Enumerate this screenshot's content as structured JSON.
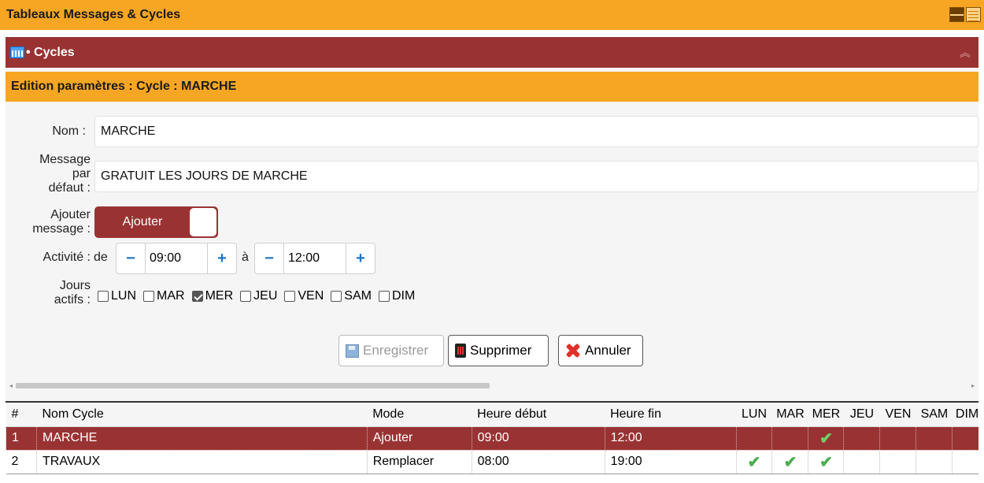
{
  "app": {
    "title": "Tableaux Messages & Cycles"
  },
  "panel": {
    "title": "• Cycles"
  },
  "edit": {
    "title": "Edition paramètres : Cycle : MARCHE",
    "nom_label": "Nom :",
    "nom_value": "MARCHE",
    "message_label_1": "Message",
    "message_label_2": "par",
    "message_label_3": "défaut :",
    "message_value": "GRATUIT LES JOURS DE MARCHE",
    "ajouter_label_1": "Ajouter",
    "ajouter_label_2": "message :",
    "toggle_label": "Ajouter",
    "activite_label": "Activité :",
    "de_label": "de",
    "a_label": "à",
    "start_time": "09:00",
    "end_time": "12:00",
    "minus": "−",
    "plus": "+",
    "jours_label_1": "Jours",
    "jours_label_2": "actifs :",
    "days": [
      {
        "label": "LUN",
        "checked": false
      },
      {
        "label": "MAR",
        "checked": false
      },
      {
        "label": "MER",
        "checked": true
      },
      {
        "label": "JEU",
        "checked": false
      },
      {
        "label": "VEN",
        "checked": false
      },
      {
        "label": "SAM",
        "checked": false
      },
      {
        "label": "DIM",
        "checked": false
      }
    ],
    "save_label": "Enregistrer",
    "delete_label": "Supprimer",
    "cancel_label": "Annuler"
  },
  "table": {
    "headers": [
      "#",
      "Nom Cycle",
      "Mode",
      "Heure début",
      "Heure fin",
      "LUN",
      "MAR",
      "MER",
      "JEU",
      "VEN",
      "SAM",
      "DIM"
    ],
    "rows": [
      {
        "num": "1",
        "name": "MARCHE",
        "mode": "Ajouter",
        "start": "09:00",
        "end": "12:00",
        "days": [
          false,
          false,
          true,
          false,
          false,
          false,
          false
        ]
      },
      {
        "num": "2",
        "name": "TRAVAUX",
        "mode": "Remplacer",
        "start": "08:00",
        "end": "19:00",
        "days": [
          true,
          true,
          true,
          false,
          false,
          false,
          false
        ]
      }
    ],
    "check_glyph": "✔"
  }
}
